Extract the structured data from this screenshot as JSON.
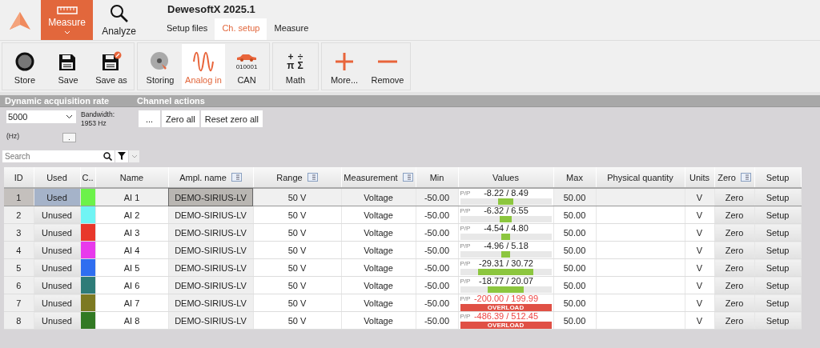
{
  "app_title": "DewesoftX 2025.1",
  "modes": [
    {
      "label": "Measure",
      "kind": "ruler",
      "selected": true
    },
    {
      "label": "Analyze",
      "kind": "search",
      "selected": false
    }
  ],
  "tabs": [
    {
      "label": "Setup files",
      "selected": false
    },
    {
      "label": "Ch. setup",
      "selected": true
    },
    {
      "label": "Measure",
      "selected": false
    }
  ],
  "toolbar_groups": [
    {
      "items": [
        {
          "label": "Store",
          "kind": "record",
          "selected": false
        },
        {
          "label": "Save",
          "kind": "floppy",
          "selected": false
        },
        {
          "label": "Save as",
          "kind": "floppy-edit",
          "selected": false
        }
      ]
    },
    {
      "items": [
        {
          "label": "Storing",
          "kind": "disk",
          "selected": false
        },
        {
          "label": "Analog in",
          "kind": "wave",
          "selected": true
        },
        {
          "label": "CAN",
          "kind": "car",
          "caption": "010001",
          "selected": false
        }
      ]
    },
    {
      "items": [
        {
          "label": "Math",
          "kind": "math",
          "glyphs": [
            "+",
            "÷",
            "π",
            "Σ"
          ],
          "selected": false
        }
      ]
    },
    {
      "items": [
        {
          "label": "More...",
          "kind": "plus",
          "selected": false
        },
        {
          "label": "Remove",
          "kind": "minus",
          "selected": false
        }
      ]
    }
  ],
  "rate_panel": {
    "title": "Dynamic acquisition rate",
    "rate": "5000",
    "unit": "(Hz)",
    "bandwidth_label": "Bandwidth:",
    "bandwidth_value": "1953 Hz",
    "small_button": "."
  },
  "channel_actions": {
    "title": "Channel actions",
    "buttons": [
      "...",
      "Zero all",
      "Reset zero all"
    ]
  },
  "search": {
    "placeholder": "Search"
  },
  "table": {
    "columns": [
      {
        "label": "ID",
        "menu": false
      },
      {
        "label": "Used",
        "menu": false
      },
      {
        "label": "C..",
        "menu": false
      },
      {
        "label": "Name",
        "menu": false
      },
      {
        "label": "Ampl. name",
        "menu": true
      },
      {
        "label": "Range",
        "menu": true
      },
      {
        "label": "Measurement",
        "menu": true
      },
      {
        "label": "Min",
        "menu": false
      },
      {
        "label": "Values",
        "menu": false
      },
      {
        "label": "Max",
        "menu": false
      },
      {
        "label": "Physical quantity",
        "menu": false
      },
      {
        "label": "Units",
        "menu": false
      },
      {
        "label": "Zero",
        "menu": true
      },
      {
        "label": "Setup",
        "menu": false
      }
    ],
    "rows": [
      {
        "id": "1",
        "used": "Used",
        "used_on": true,
        "color": "#6cf24a",
        "name": "AI 1",
        "ampl": "DEMO-SIRIUS-LV",
        "range": "50 V",
        "measurement": "Voltage",
        "min": "-50.00",
        "pp": "P/P",
        "values": "-8.22 / 8.49",
        "level": 0.17,
        "overload": false,
        "max": "50.00",
        "units": "V",
        "zero": "Zero",
        "setup": "Setup",
        "selected": true
      },
      {
        "id": "2",
        "used": "Unused",
        "used_on": false,
        "color": "#70f4f4",
        "name": "AI 2",
        "ampl": "DEMO-SIRIUS-LV",
        "range": "50 V",
        "measurement": "Voltage",
        "min": "-50.00",
        "pp": "P/P",
        "values": "-6.32 / 6.55",
        "level": 0.13,
        "overload": false,
        "max": "50.00",
        "units": "V",
        "zero": "Zero",
        "setup": "Setup",
        "selected": false
      },
      {
        "id": "3",
        "used": "Unused",
        "used_on": false,
        "color": "#e8372a",
        "name": "AI 3",
        "ampl": "DEMO-SIRIUS-LV",
        "range": "50 V",
        "measurement": "Voltage",
        "min": "-50.00",
        "pp": "P/P",
        "values": "-4.54 / 4.80",
        "level": 0.09,
        "overload": false,
        "max": "50.00",
        "units": "V",
        "zero": "Zero",
        "setup": "Setup",
        "selected": false
      },
      {
        "id": "4",
        "used": "Unused",
        "used_on": false,
        "color": "#e83aec",
        "name": "AI 4",
        "ampl": "DEMO-SIRIUS-LV",
        "range": "50 V",
        "measurement": "Voltage",
        "min": "-50.00",
        "pp": "P/P",
        "values": "-4.96 / 5.18",
        "level": 0.1,
        "overload": false,
        "max": "50.00",
        "units": "V",
        "zero": "Zero",
        "setup": "Setup",
        "selected": false
      },
      {
        "id": "5",
        "used": "Unused",
        "used_on": false,
        "color": "#2f6ef0",
        "name": "AI 5",
        "ampl": "DEMO-SIRIUS-LV",
        "range": "50 V",
        "measurement": "Voltage",
        "min": "-50.00",
        "pp": "P/P",
        "values": "-29.31 / 30.72",
        "level": 0.6,
        "overload": false,
        "max": "50.00",
        "units": "V",
        "zero": "Zero",
        "setup": "Setup",
        "selected": false
      },
      {
        "id": "6",
        "used": "Unused",
        "used_on": false,
        "color": "#2e7c78",
        "name": "AI 6",
        "ampl": "DEMO-SIRIUS-LV",
        "range": "50 V",
        "measurement": "Voltage",
        "min": "-50.00",
        "pp": "P/P",
        "values": "-18.77 / 20.07",
        "level": 0.39,
        "overload": false,
        "max": "50.00",
        "units": "V",
        "zero": "Zero",
        "setup": "Setup",
        "selected": false
      },
      {
        "id": "7",
        "used": "Unused",
        "used_on": false,
        "color": "#7d7a22",
        "name": "AI 7",
        "ampl": "DEMO-SIRIUS-LV",
        "range": "50 V",
        "measurement": "Voltage",
        "min": "-50.00",
        "pp": "P/P",
        "values": "-200.00 / 199.99",
        "overload": true,
        "overload_text": "OVERLOAD",
        "max": "50.00",
        "units": "V",
        "zero": "Zero",
        "setup": "Setup",
        "selected": false
      },
      {
        "id": "8",
        "used": "Unused",
        "used_on": false,
        "color": "#327a24",
        "name": "AI 8",
        "ampl": "DEMO-SIRIUS-LV",
        "range": "50 V",
        "measurement": "Voltage",
        "min": "-50.00",
        "pp": "P/P",
        "values": "-486.39 / 512.45",
        "overload": true,
        "overload_text": "OVERLOAD",
        "max": "50.00",
        "units": "V",
        "zero": "Zero",
        "setup": "Setup",
        "selected": false
      }
    ]
  }
}
